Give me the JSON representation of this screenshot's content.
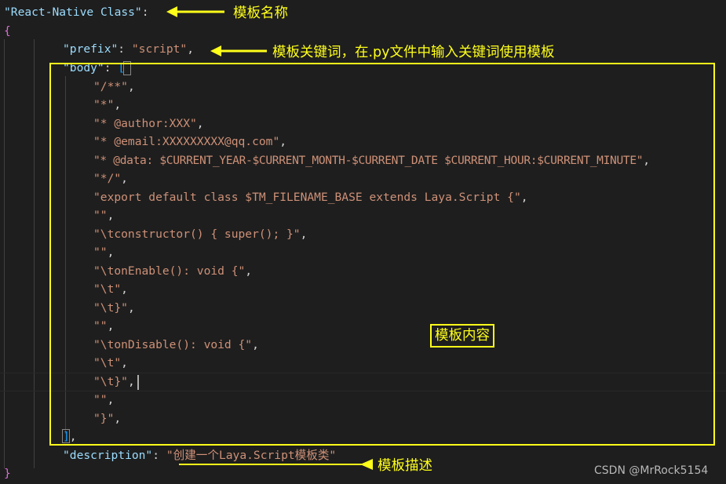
{
  "colors": {
    "background": "#1e1e1e",
    "key": "#9cdcfe",
    "string": "#ce9178",
    "punctuation": "#d4d4d4",
    "bracket_level1": "#da70d6",
    "bracket_level2": "#179fff",
    "annotation": "#ffff1a",
    "watermark": "#b8b8b8"
  },
  "code": {
    "name_key": "\"React-Native Class\"",
    "colon": ":",
    "open_brace": "{",
    "close_brace": "}",
    "prefix_key": "\"prefix\"",
    "prefix_value": "\"script\"",
    "body_key": "\"body\"",
    "open_bracket": "[",
    "close_bracket": "]",
    "comma": ",",
    "body_lines": [
      "\"/**\"",
      "\"*\"",
      "\"* @author:XXX\"",
      "\"* @email:XXXXXXXXX@qq.com\"",
      "\"* @data: $CURRENT_YEAR-$CURRENT_MONTH-$CURRENT_DATE $CURRENT_HOUR:$CURRENT_MINUTE\"",
      "\"*/\"",
      "\"export default class $TM_FILENAME_BASE extends Laya.Script {\"",
      "\"\"",
      "\"\\tconstructor() { super(); }\"",
      "\"\"",
      "\"\\tonEnable(): void {\"",
      "\"\\t\"",
      "\"\\t}\"",
      "\"\"",
      "\"\\tonDisable(): void {\"",
      "\"\\t\"",
      "\"\\t}\"",
      "\"\"",
      "\"}\""
    ],
    "description_key": "\"description\"",
    "description_value": "\"创建一个Laya.Script模板类\""
  },
  "annotations": {
    "template_name": "模板名称",
    "template_keyword": "模板关键词，在.py文件中输入关键词使用模板",
    "template_content": "模板内容",
    "template_description": "模板描述"
  },
  "watermark": "CSDN @MrRock5154"
}
